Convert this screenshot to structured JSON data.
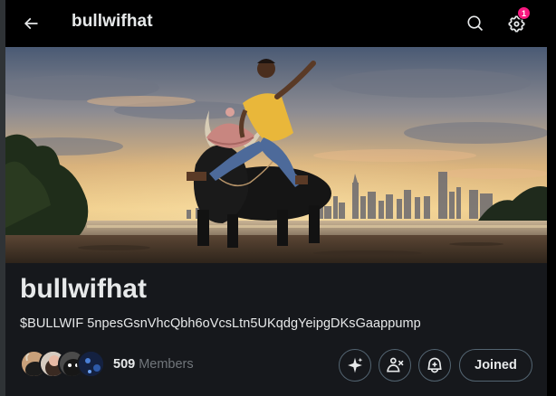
{
  "header": {
    "title": "bullwifhat",
    "notification_count": "1"
  },
  "community": {
    "name": "bullwifhat",
    "description": "$BULLWIF 5npesGsnVhcQbh6oVcsLtn5UKqdgYeipgDKsGaappump",
    "member_count": "509",
    "member_label": "Members",
    "joined_label": "Joined"
  },
  "icons": {
    "back": "arrow-left-icon",
    "search": "search-icon",
    "settings": "gear-icon",
    "grok": "sparkle-icon",
    "invite": "add-person-icon",
    "notify": "bell-plus-icon"
  },
  "colors": {
    "background": "#000000",
    "panel": "#16181c",
    "text": "#e7e9ea",
    "muted": "#71767b",
    "border": "#536471",
    "badge": "#f91880"
  }
}
